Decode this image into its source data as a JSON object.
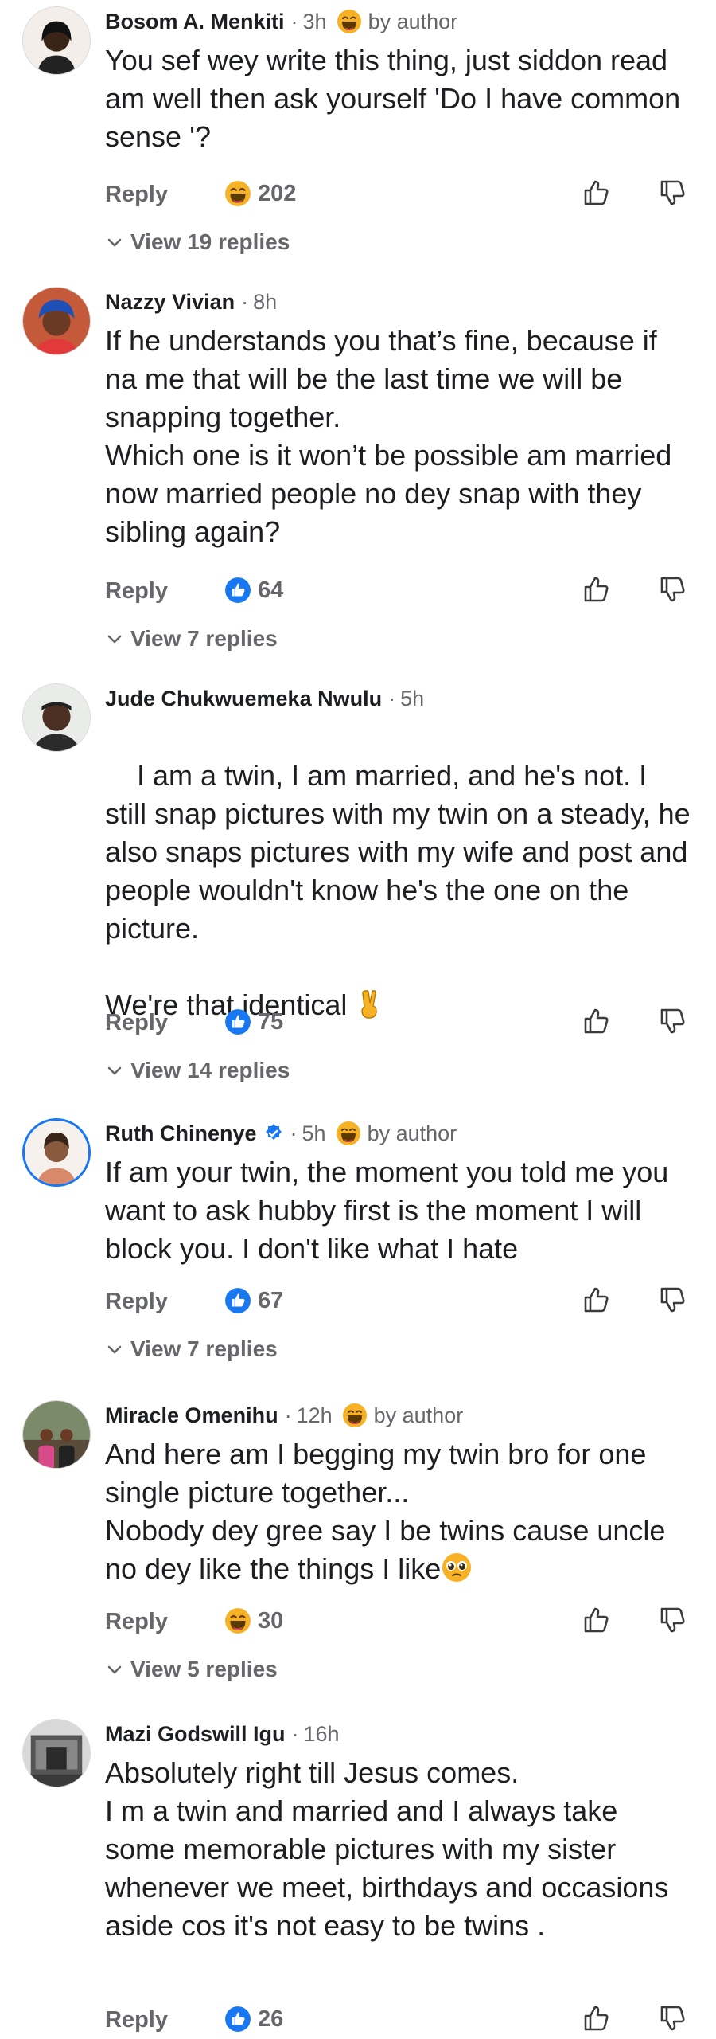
{
  "reply_label": "Reply",
  "comments": [
    {
      "name": "Bosom A. Menkiti",
      "time": "3h",
      "author_badge": "by author",
      "text": "You sef wey write this thing, just siddon read am well then ask yourself 'Do I have common sense '?",
      "reaction": "laugh",
      "count": "202",
      "view_replies": "View 19 replies"
    },
    {
      "name": "Nazzy Vivian",
      "time": "8h",
      "text": "If he understands you that’s fine, because if na me that will be the last time we will be snapping together.\nWhich one is it won’t be possible am married now married people no dey snap with they sibling again?",
      "reaction": "like",
      "count": "64",
      "view_replies": "View 7 replies"
    },
    {
      "name": "Jude Chukwuemeka Nwulu",
      "time": "5h",
      "text": "I am a twin, I am married, and he's not. I still snap pictures with my twin on a steady, he also snaps pictures with my wife and post and people wouldn't know he's the one on the picture.",
      "text2": "We're that identical",
      "reaction": "like",
      "count": "75",
      "view_replies": "View 14 replies"
    },
    {
      "name": "Ruth Chinenye",
      "time": "5h",
      "author_badge": "by author",
      "verified": true,
      "text": "If am your twin, the moment you told me you want to ask hubby first is the moment I will block you. I don't like what I hate",
      "reaction": "like",
      "count": "67",
      "view_replies": "View 7 replies"
    },
    {
      "name": "Miracle Omenihu",
      "time": "12h",
      "author_badge": "by author",
      "text": "And here am I begging my twin bro for one single picture together...\nNobody dey gree say I be twins cause uncle no dey like the things I like",
      "reaction": "laugh",
      "count": "30",
      "view_replies": "View 5 replies"
    },
    {
      "name": "Mazi Godswill Igu",
      "time": "16h",
      "text": "Absolutely right till Jesus comes.\nI m a twin and married and I always take some memorable pictures with my sister whenever we meet, birthdays and occasions aside cos it's not easy to be twins .",
      "reaction": "like",
      "count": "26"
    }
  ],
  "colors": {
    "text": "#1c1e21",
    "muted": "#65676b",
    "like_blue": "#1877f2",
    "emoji_yellow": "#f7b125"
  }
}
